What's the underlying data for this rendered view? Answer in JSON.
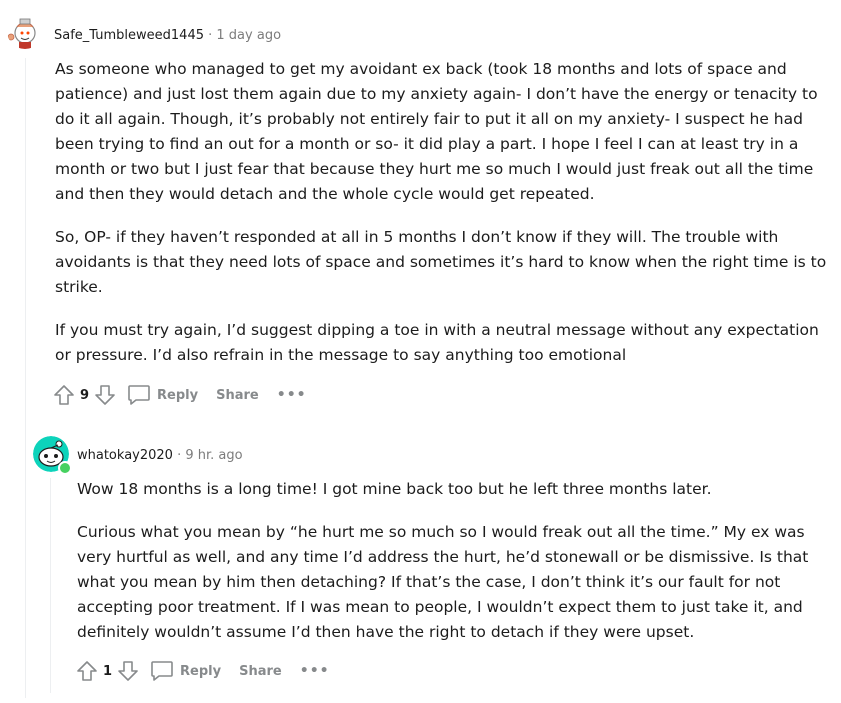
{
  "comments": [
    {
      "username": "Safe_Tumbleweed1445",
      "time": "1 day ago",
      "paragraphs": [
        "As someone who managed to get my avoidant ex back (took 18 months and lots of space and patience) and just lost them again due to my anxiety again- I don’t have the energy or tenacity to do it all again. Though, it’s probably not entirely fair to put it all on my anxiety- I suspect he had been trying to find an out for a month or so- it did play a part. I hope I feel I can at least try in a month or two but I just fear that because they hurt me so much I would just freak out all the time and then they would detach and the whole cycle would get repeated.",
        "So, OP- if they haven’t responded at all in 5 months I don’t know if they will. The trouble with avoidants is that they need lots of space and sometimes it’s hard to know when the right time is to strike.",
        "If you must try again, I’d suggest dipping a toe in with a neutral message without any expectation or pressure. I’d also refrain in the message to say anything too emotional"
      ],
      "votes": "9",
      "reply_label": "Reply",
      "share_label": "Share",
      "more_label": "•••"
    },
    {
      "username": "whatokay2020",
      "time": "9 hr. ago",
      "paragraphs": [
        "Wow 18 months is a long time! I got mine back too but he left three months later.",
        "Curious what you mean by “he hurt me so much so I would freak out all the time.” My ex was very hurtful as well, and any time I’d address the hurt, he’d stonewall or be dismissive. Is that what you mean by him then detaching? If that’s the case, I don’t think it’s our fault for not accepting poor treatment. If I was mean to people, I wouldn’t expect them to just take it, and definitely wouldn’t assume I’d then have the right to detach if they were upset."
      ],
      "votes": "1",
      "reply_label": "Reply",
      "share_label": "Share",
      "more_label": "•••"
    }
  ],
  "colors": {
    "username": "#1c1c1c",
    "meta_gray": "#7c7c7c",
    "action_gray": "#878a8c",
    "online": "#46d160",
    "avatar1_bg": "#f6f7f8",
    "avatar2_bg": "#0dd3bb"
  }
}
